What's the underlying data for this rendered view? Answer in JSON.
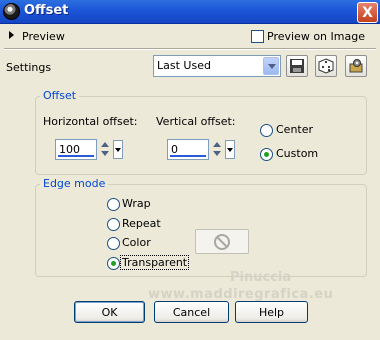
{
  "window": {
    "title": "Offset",
    "close_glyph": "X"
  },
  "preview": {
    "label": "Preview",
    "on_image_label": "Preview on Image",
    "on_image_checked": false
  },
  "settings": {
    "label": "Settings",
    "selected": "Last Used"
  },
  "offset_group": {
    "title": "Offset",
    "horizontal_label": "Horizontal offset:",
    "horizontal_value": "100",
    "vertical_label": "Vertical offset:",
    "vertical_value": "0",
    "options": [
      "Center",
      "Custom"
    ],
    "selected": "Custom"
  },
  "edge_group": {
    "title": "Edge mode",
    "options": [
      "Wrap",
      "Repeat",
      "Color",
      "Transparent"
    ],
    "selected": "Transparent"
  },
  "watermark": {
    "line1": "Pinuccia",
    "line2": "www.maddiregrafica.eu"
  },
  "buttons": {
    "ok": "OK",
    "cancel": "Cancel",
    "help": "Help"
  },
  "colors": {
    "titlebar": "#1c56d8",
    "group_title": "#0046d5",
    "radio_dot": "#21a121"
  }
}
